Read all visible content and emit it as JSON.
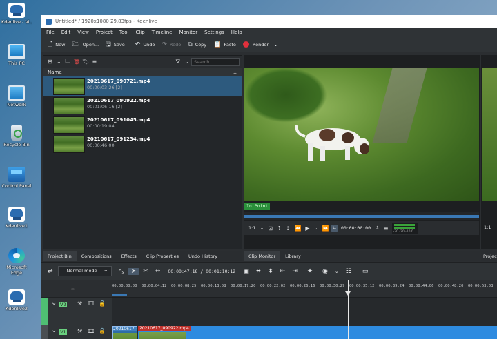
{
  "desktop": {
    "icons": [
      {
        "label": "Kdenlive - Vi..."
      },
      {
        "label": "This PC"
      },
      {
        "label": "Network"
      },
      {
        "label": "Recycle Bin"
      },
      {
        "label": "Control Panel"
      },
      {
        "label": "Kdenlive1"
      },
      {
        "label": "Microsoft Edge"
      },
      {
        "label": "Kdenlive2"
      }
    ]
  },
  "window": {
    "title": "Untitled* / 1920x1080 29.83fps - Kdenlive"
  },
  "menu": [
    "File",
    "Edit",
    "View",
    "Project",
    "Tool",
    "Clip",
    "Timeline",
    "Monitor",
    "Settings",
    "Help"
  ],
  "toolbar": {
    "new": "New",
    "open": "Open...",
    "save": "Save",
    "undo": "Undo",
    "redo": "Redo",
    "copy": "Copy",
    "paste": "Paste",
    "render": "Render"
  },
  "bin": {
    "search_placeholder": "Search...",
    "column_name": "Name",
    "clips": [
      {
        "name": "20210617_090721.mp4",
        "duration": "00:00:03:26 [2]"
      },
      {
        "name": "20210617_090922.mp4",
        "duration": "00:01:06:16 [2]"
      },
      {
        "name": "20210617_091045.mp4",
        "duration": "00:00:19:04"
      },
      {
        "name": "20210617_091234.mp4",
        "duration": "00:00:46:00"
      }
    ]
  },
  "monitor": {
    "in_point": "In Point",
    "zoom": "1:1",
    "timecode": "00:00:00:00",
    "meter_scale": "-30 -20 -10  0"
  },
  "tabs_left": [
    "Project Bin",
    "Compositions",
    "Effects",
    "Clip Properties",
    "Undo History"
  ],
  "tabs_monitor": [
    "Clip Monitor",
    "Library"
  ],
  "tabs_right": [
    "Project"
  ],
  "right_monitor": {
    "zoom": "1:1"
  },
  "timeline": {
    "mode": "Normal mode",
    "timecode": "00:00:47:18 / 00:01:10:12",
    "ruler": [
      "00:00:00:00",
      "00:00:04:12",
      "00:00:08:25",
      "00:00:13:08",
      "00:00:17:20",
      "00:00:22:02",
      "00:00:26:16",
      "00:00:30:29",
      "00:00:35:12",
      "00:00:39:24",
      "00:00:44:06",
      "00:00:48:20",
      "00:00:53:03"
    ],
    "tracks": [
      {
        "name": "V2"
      },
      {
        "name": "V1"
      }
    ],
    "clips": [
      {
        "label": "20210617_0"
      },
      {
        "label": "20210617_090922.mp4"
      }
    ]
  }
}
